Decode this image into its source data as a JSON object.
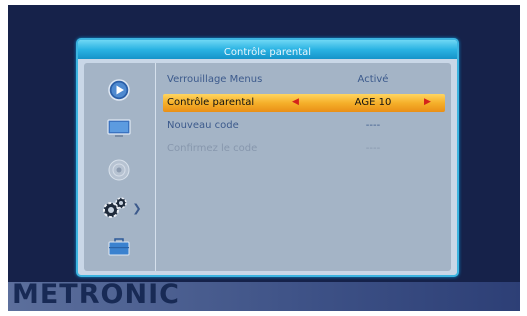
{
  "window": {
    "title": "Contrôle parental"
  },
  "sidebar": {
    "items": [
      {
        "icon": "play-icon"
      },
      {
        "icon": "monitor-icon"
      },
      {
        "icon": "disc-icon"
      },
      {
        "icon": "gears-icon",
        "active": true
      },
      {
        "icon": "toolbox-icon"
      }
    ]
  },
  "menu": {
    "rows": [
      {
        "label": "Verrouillage Menus",
        "value": "Activé"
      },
      {
        "label": "Contrôle parental",
        "value": "AGE 10",
        "selected": true
      },
      {
        "label": "Nouveau code",
        "value": "----"
      },
      {
        "label": "Confirmez le code",
        "value": "----",
        "disabled": true
      }
    ]
  },
  "brand": {
    "name": "METRONIC"
  },
  "colors": {
    "background": "#16224a",
    "window": "#c9d7e7",
    "titlebar": "#2ab3e3",
    "selection": "#f5b02a",
    "arrow": "#d4231b"
  }
}
